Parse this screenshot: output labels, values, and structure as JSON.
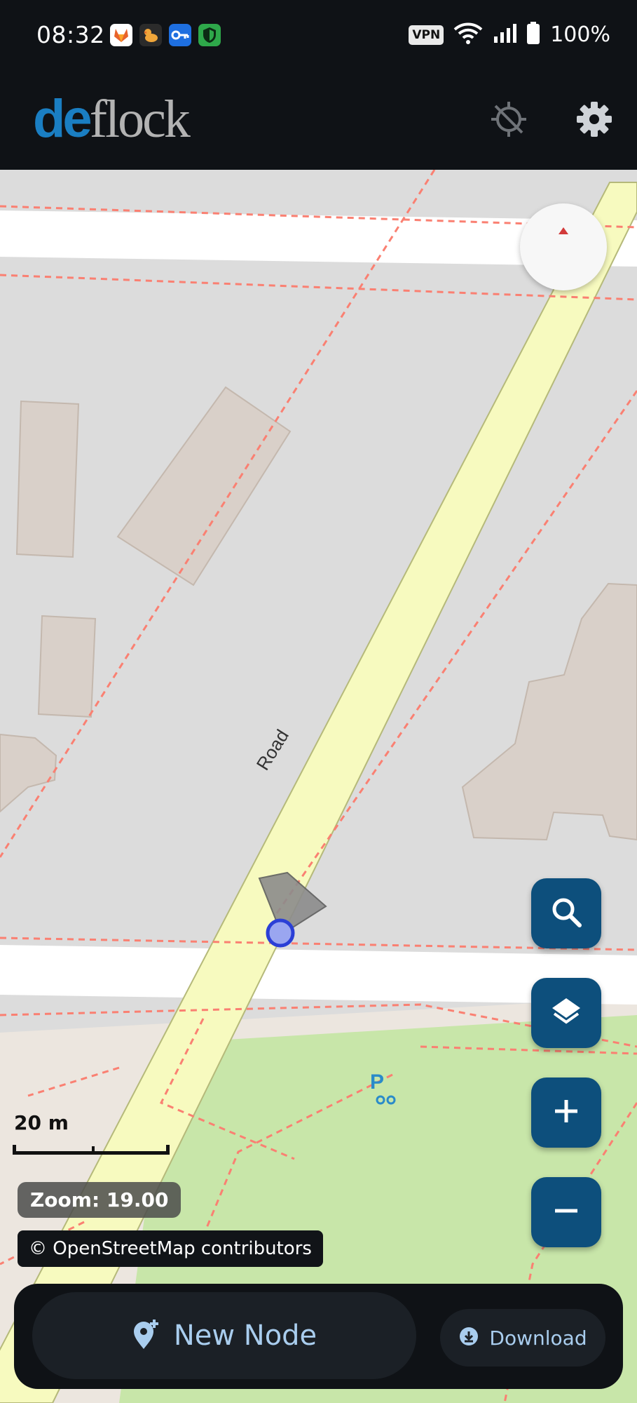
{
  "status_bar": {
    "time": "08:32",
    "apps": [
      {
        "icon": "gitlab-fox-icon",
        "bg": "#ffffff"
      },
      {
        "icon": "duck-icon",
        "bg": "#2b2b2b"
      },
      {
        "icon": "key-icon",
        "bg": "#1e6fe0"
      },
      {
        "icon": "shield-icon",
        "bg": "#2ea84a"
      }
    ],
    "vpn": "VPN",
    "battery": "100%"
  },
  "app_bar": {
    "logo_de": "de",
    "logo_flock": "flock",
    "icons": [
      "location-disabled-icon",
      "gear-icon"
    ]
  },
  "map": {
    "road_label": "Road",
    "scale_label": "20 m",
    "zoom_text": "Zoom: 19.00",
    "attribution": "© OpenStreetMap contributors",
    "colors": {
      "background": "#dcdcdc",
      "building": "#d9d0c9",
      "main_road": "#f7fabf",
      "street": "#ffffff",
      "park": "#c8e6a9",
      "path": "#fa8072",
      "location": "#2b3fd6"
    }
  },
  "fabs": [
    {
      "name": "search-button",
      "icon": "search-icon"
    },
    {
      "name": "layers-button",
      "icon": "layers-icon"
    },
    {
      "name": "zoom-in-button",
      "icon": "plus-icon"
    },
    {
      "name": "zoom-out-button",
      "icon": "minus-icon"
    }
  ],
  "bottom_bar": {
    "new_node_label": "New Node",
    "download_label": "Download"
  },
  "accent": "#0d4f7c"
}
